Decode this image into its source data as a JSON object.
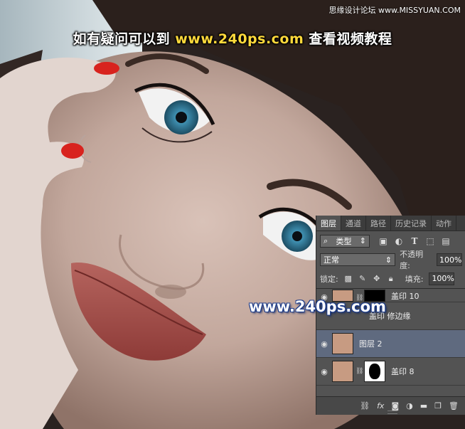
{
  "banner": {
    "prefix": "如有疑问可以到",
    "url": "www.240ps.com",
    "suffix": "查看视频教程"
  },
  "site_watermark": "思缘设计论坛 www.MISSYUAN.COM",
  "mid_watermark": "www.240ps.com",
  "layers_panel": {
    "tabs": [
      "图层",
      "通道",
      "路径",
      "历史记录",
      "动作"
    ],
    "filter": {
      "kind_label": "类型",
      "icons": [
        "image-filter-icon",
        "adjustment-filter-icon",
        "type-filter-icon",
        "shape-filter-icon",
        "smart-object-filter-icon"
      ]
    },
    "blend_mode": "正常",
    "opacity_label": "不透明度:",
    "opacity_value": "100%",
    "lock_label": "锁定:",
    "fill_label": "填充:",
    "fill_value": "100%",
    "layers": [
      {
        "name": "盖印 10",
        "visible": true,
        "has_mask": true,
        "selected": false
      },
      {
        "name": "盖印 修边缘",
        "visible": false,
        "has_mask": false,
        "selected": false
      },
      {
        "name": "图层 2",
        "visible": true,
        "has_mask": false,
        "selected": true
      },
      {
        "name": "盖印 8",
        "visible": true,
        "has_mask": true,
        "selected": false
      }
    ],
    "bottom_icons": [
      "link-layers-icon",
      "fx-icon",
      "add-mask-icon",
      "new-adjustment-icon",
      "new-group-icon",
      "new-layer-icon"
    ],
    "fx_label": "fx"
  }
}
